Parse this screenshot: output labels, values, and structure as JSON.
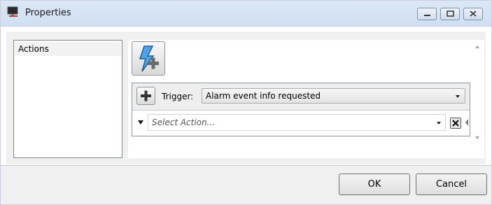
{
  "window": {
    "title": "Properties",
    "controls": [
      "minimize",
      "maximize",
      "close"
    ]
  },
  "left_panel": {
    "items": [
      {
        "label": "Actions"
      }
    ]
  },
  "toolbar": {
    "add_trigger_icon": "lightning-plus-icon"
  },
  "trigger": {
    "label": "Trigger:",
    "selected": "Alarm event info requested"
  },
  "action": {
    "placeholder": "Select Action..."
  },
  "buttons": {
    "ok": "OK",
    "cancel": "Cancel"
  },
  "colors": {
    "titlebar": "#d6e4f4",
    "panel": "#f0f0f0",
    "accent": "#3a7bd5"
  }
}
